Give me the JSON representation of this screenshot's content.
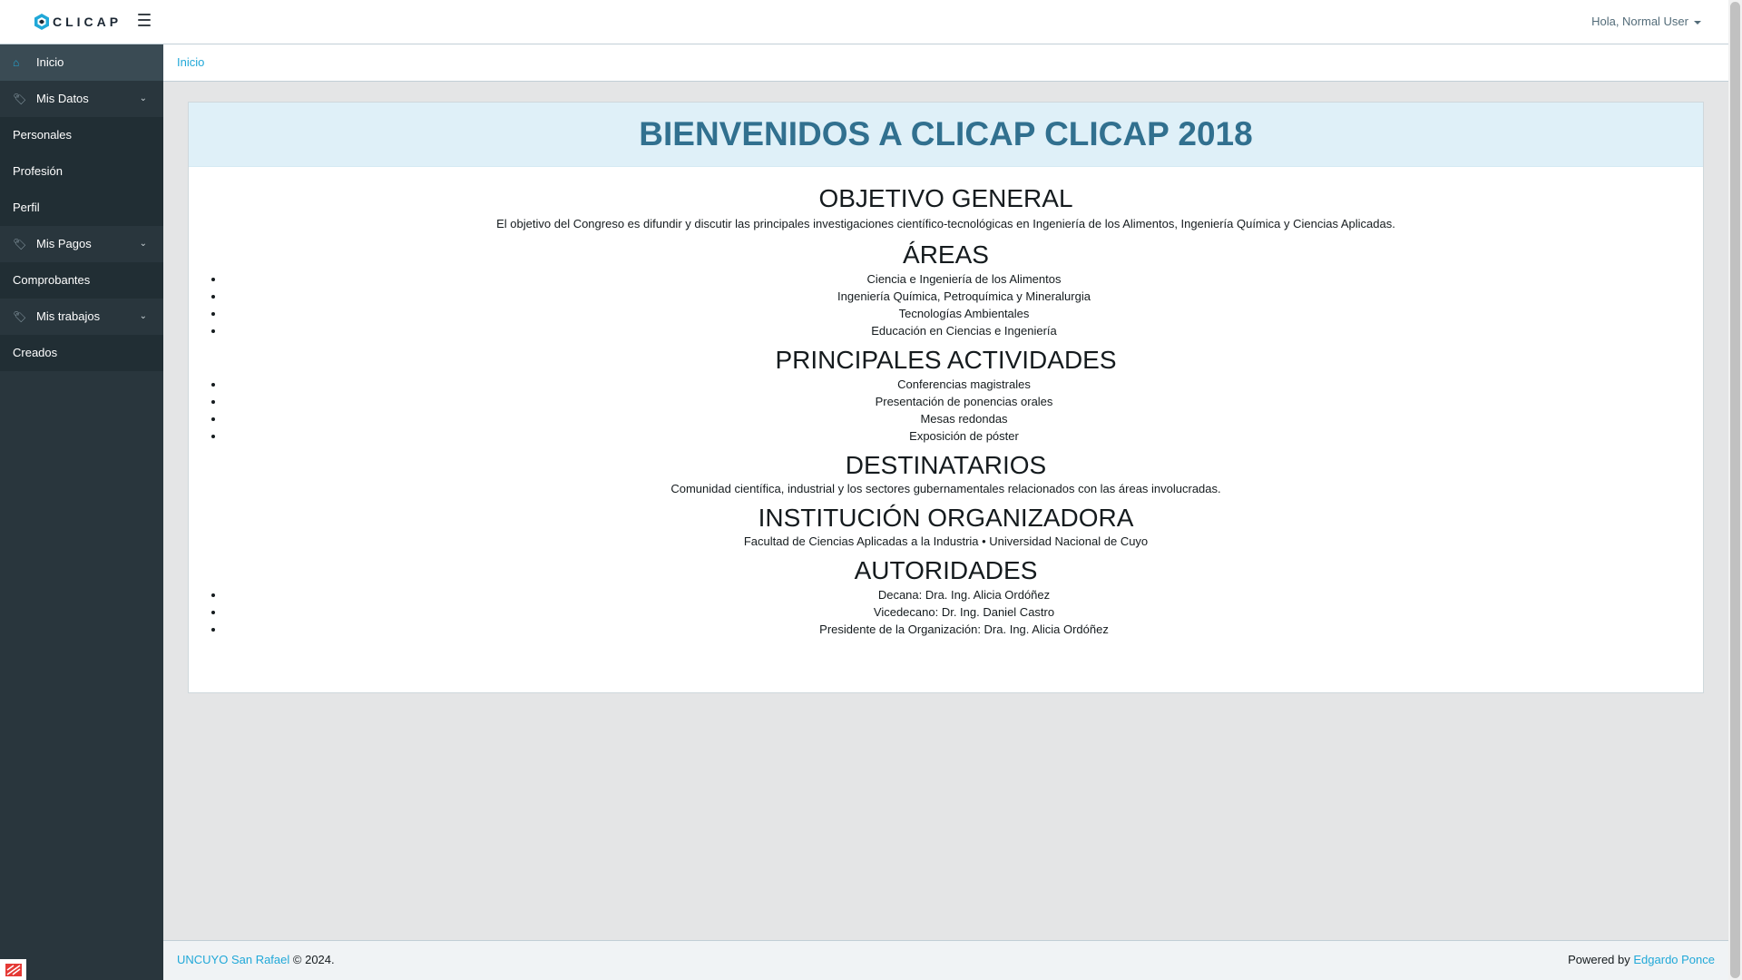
{
  "header": {
    "logo_text": "CLICAP",
    "user_greeting": "Hola, Normal User"
  },
  "sidebar": {
    "items": [
      {
        "label": "Inicio",
        "icon": "home-icon",
        "active": true
      },
      {
        "label": "Mis Datos",
        "icon": "tag-icon"
      },
      {
        "label": "Personales"
      },
      {
        "label": "Profesión"
      },
      {
        "label": "Perfil"
      },
      {
        "label": "Mis Pagos",
        "icon": "tag-icon"
      },
      {
        "label": "Comprobantes"
      },
      {
        "label": "Mis trabajos",
        "icon": "tag-icon"
      },
      {
        "label": "Creados"
      }
    ]
  },
  "breadcrumb": {
    "current": "Inicio"
  },
  "main": {
    "title": "BIENVENIDOS A CLICAP CLICAP 2018",
    "objetivo": {
      "heading": "OBJETIVO GENERAL",
      "text": "El objetivo del Congreso es difundir y discutir las principales investigaciones científico-tecnológicas en Ingeniería de los Alimentos, Ingeniería Química y Ciencias Aplicadas."
    },
    "areas": {
      "heading": "ÁREAS",
      "items": [
        "Ciencia e Ingeniería de los Alimentos",
        "Ingeniería Química, Petroquímica y Mineralurgia",
        "Tecnologías Ambientales",
        "Educación en Ciencias e Ingeniería"
      ]
    },
    "actividades": {
      "heading": "PRINCIPALES ACTIVIDADES",
      "items": [
        "Conferencias magistrales",
        "Presentación de ponencias orales",
        "Mesas redondas",
        "Exposición de póster"
      ]
    },
    "destinatarios": {
      "heading": "DESTINATARIOS",
      "text": "Comunidad científica, industrial y los sectores gubernamentales relacionados con las áreas involucradas."
    },
    "institucion": {
      "heading": "INSTITUCIÓN ORGANIZADORA",
      "text": "Facultad de Ciencias Aplicadas a la Industria • Universidad Nacional de Cuyo"
    },
    "autoridades": {
      "heading": "AUTORIDADES",
      "items": [
        "Decana: Dra. Ing. Alicia Ordóñez",
        "Vicedecano: Dr. Ing. Daniel Castro",
        "Presidente de la Organización: Dra. Ing. Alicia Ordóñez"
      ]
    }
  },
  "footer": {
    "org_link": "UNCUYO San Rafael",
    "copyright": "© 2024.",
    "powered_by": "Powered by",
    "author_link": "Edgardo Ponce"
  },
  "colors": {
    "sidebar_bg": "#29363d",
    "accent": "#20a8d8",
    "title_color": "#31708f",
    "title_bg": "#dff0f8"
  }
}
